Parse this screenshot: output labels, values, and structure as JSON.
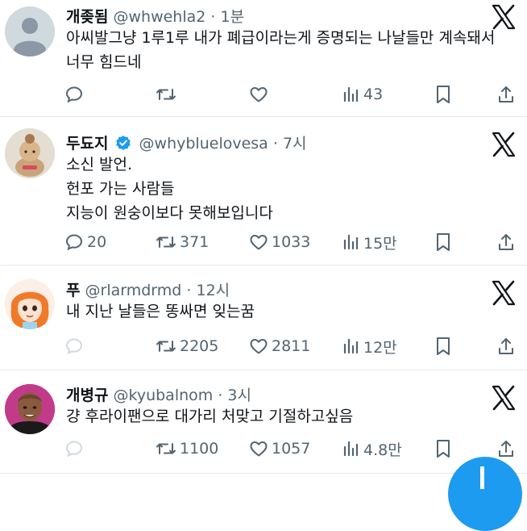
{
  "tweets": [
    {
      "name": "개좆됨",
      "handle": "@whwehla2",
      "dot": "·",
      "time": "1분",
      "verified": false,
      "lines": [
        "아씨발그냥 1루1루 내가 폐급이라는게 증명되는 나날들만 계속돼서",
        "너무 힘드네"
      ],
      "replies": "",
      "retweets": "",
      "likes": "",
      "views": "43",
      "reply_dimmed": false
    },
    {
      "name": "두됴지",
      "handle": "@whybluelovesa",
      "dot": "·",
      "time": "7시",
      "verified": true,
      "lines": [
        "소신 발언.",
        "헌포 가는 사람들",
        "지능이 원숭이보다 못해보입니다"
      ],
      "replies": "20",
      "retweets": "371",
      "likes": "1033",
      "views": "15만",
      "reply_dimmed": false
    },
    {
      "name": "푸",
      "handle": "@rlarmdrmd",
      "dot": "·",
      "time": "12시",
      "verified": false,
      "lines": [
        "내 지난 날들은 똥싸면 잊는꿈"
      ],
      "replies": "",
      "retweets": "2205",
      "likes": "2811",
      "views": "12만",
      "reply_dimmed": true
    },
    {
      "name": "개병규",
      "handle": "@kyubalnom",
      "dot": "·",
      "time": "3시",
      "verified": false,
      "lines": [
        "걍 후라이팬으로 대가리 처맞고 기절하고싶음"
      ],
      "replies": "",
      "retweets": "1100",
      "likes": "1057",
      "views": "4.8만",
      "reply_dimmed": true
    }
  ],
  "icons": {
    "x_logo": "x-logo-icon",
    "reply": "reply-icon",
    "retweet": "retweet-icon",
    "like": "heart-icon",
    "views": "views-icon",
    "bookmark": "bookmark-icon",
    "share": "share-icon",
    "compose": "compose-icon"
  },
  "colors": {
    "text": "#0f1419",
    "muted": "#536471",
    "dimmed": "#cfd9de",
    "verified": "#1d9bf0",
    "accent": "#1d9bf0",
    "divider": "#e6e9ec"
  }
}
